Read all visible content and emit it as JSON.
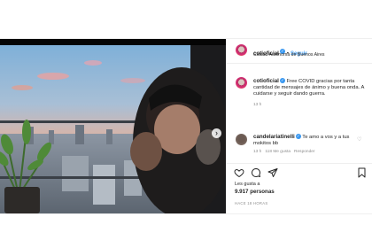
{
  "header": {
    "username": "cotioficial",
    "follow_label": "Seguir",
    "separator": "•",
    "location": "Ciudad Autónoma de Buenos Aires"
  },
  "caption": {
    "username": "cotioficial",
    "text": "Free COVID gracias por tanta cantidad de mensajes de ánimo y buena onda. A cuidarse y seguir dando guerra.",
    "time": "13 h"
  },
  "comment": {
    "username": "candelariatinelli",
    "text": "Te amo a vos y a tus mokitos bb",
    "meta": "13 h   118 Me gusta   Responder"
  },
  "likes": {
    "prefix": "Les gusta a",
    "count": "9.917 personas"
  },
  "time_ago": "HACE 18 HORAS",
  "icons": {
    "verified": "✓",
    "next": "›",
    "comment_heart": "♡"
  },
  "colors": {
    "accent": "#3897f0",
    "muted": "#8e8e8e",
    "text": "#262626"
  }
}
